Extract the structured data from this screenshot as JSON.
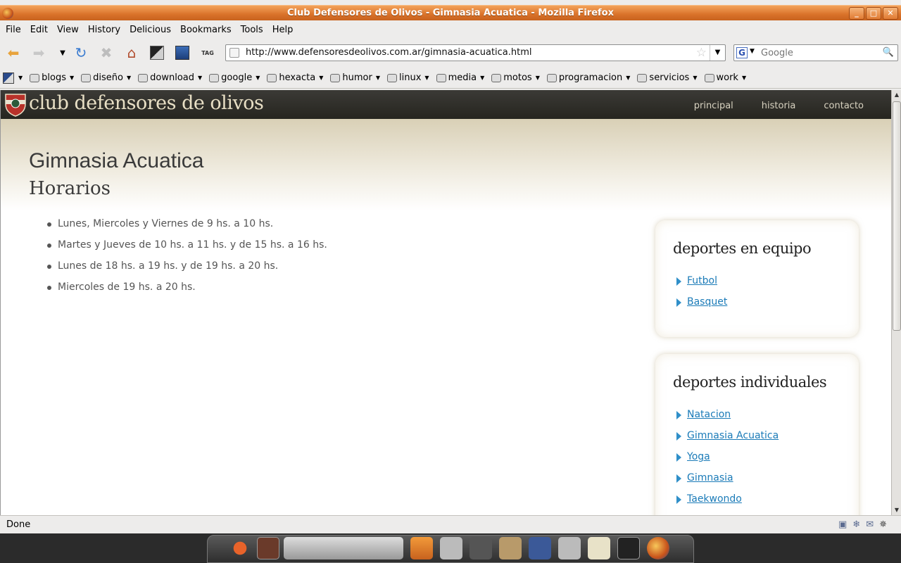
{
  "window": {
    "title": "Club Defensores de Olivos - Gimnasia Acuatica - Mozilla Firefox",
    "controls": {
      "minimize": "_",
      "maximize": "□",
      "close": "✕"
    }
  },
  "menu": [
    "File",
    "Edit",
    "View",
    "History",
    "Delicious",
    "Bookmarks",
    "Tools",
    "Help"
  ],
  "toolbar": {
    "back_icon": "back-arrow-icon",
    "forward_icon": "forward-arrow-icon",
    "reload_icon": "reload-icon",
    "stop_icon": "stop-icon",
    "home_icon": "home-icon",
    "url": "http://www.defensoresdeolivos.com.ar/gimnasia-acuatica.html",
    "search_placeholder": "Google",
    "search_engine": "G",
    "tag_label": "TAG"
  },
  "bookmarks": [
    "blogs",
    "diseño",
    "download",
    "google",
    "hexacta",
    "humor",
    "linux",
    "media",
    "motos",
    "programacion",
    "servicios",
    "work"
  ],
  "site": {
    "name": "club defensores de olivos",
    "nav": [
      "principal",
      "historia",
      "contacto"
    ],
    "page_title": "Gimnasia Acuatica",
    "page_subtitle": "Horarios",
    "schedule": [
      "Lunes, Miercoles y Viernes de 9 hs. a 10 hs.",
      "Martes y Jueves de 10 hs. a 11 hs. y de 15 hs. a 16 hs.",
      "Lunes de 18 hs. a 19 hs. y de 19 hs. a 20 hs.",
      "Miercoles de 19 hs. a 20 hs."
    ],
    "sidebar": {
      "team": {
        "title": "deportes en equipo",
        "links": [
          "Futbol",
          "Basquet"
        ]
      },
      "individual": {
        "title": "deportes individuales",
        "links": [
          "Natacion",
          "Gimnasia Acuatica",
          "Yoga",
          "Gimnasia",
          "Taekwondo"
        ]
      }
    },
    "colors": {
      "header": "#2f2e2a",
      "link": "#1b7bb8",
      "title": "#3a3a3a"
    }
  },
  "status": {
    "text": "Done"
  }
}
